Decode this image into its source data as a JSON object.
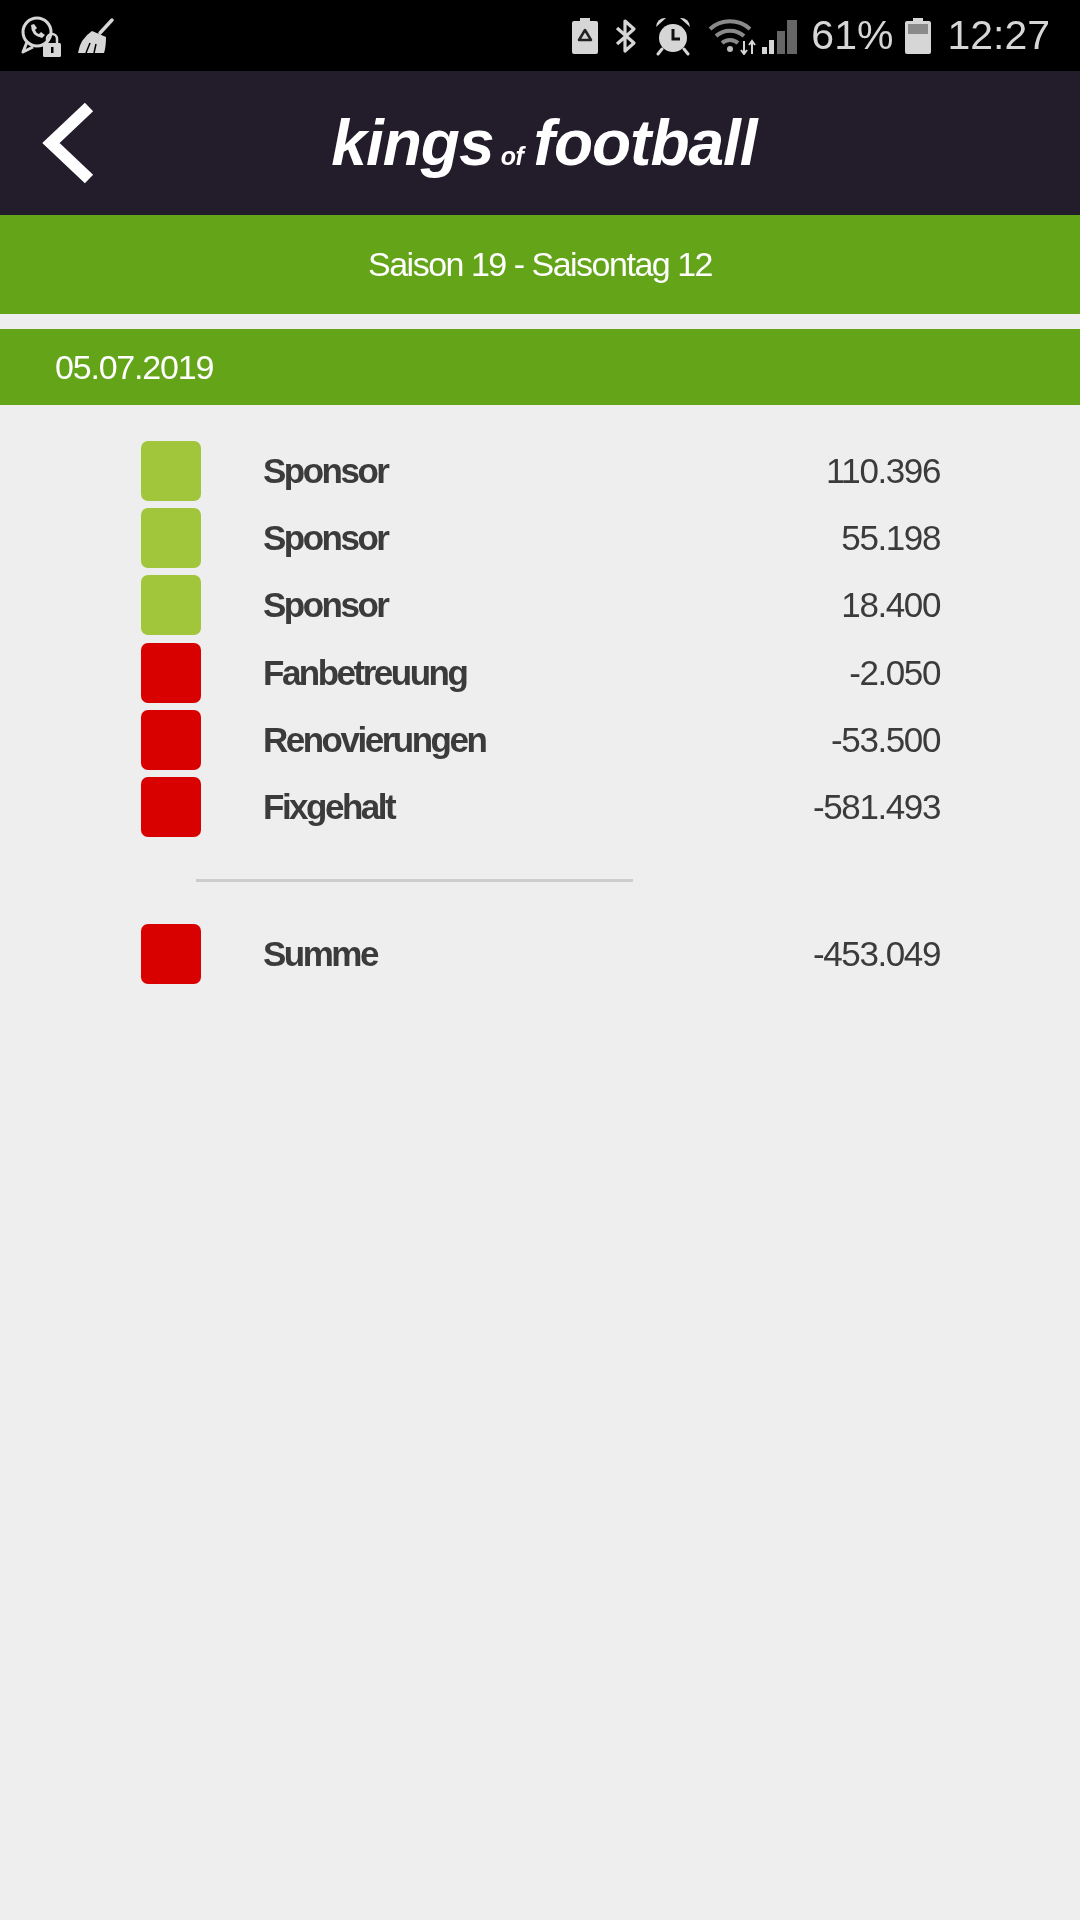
{
  "status_bar": {
    "battery_percent": "61%",
    "time": "12:27"
  },
  "header": {
    "logo": [
      {
        "text": "kings",
        "kind": "word"
      },
      {
        "text": "of",
        "kind": "small"
      },
      {
        "text": "football",
        "kind": "word"
      }
    ]
  },
  "season_bar": {
    "title": "Saison 19 - Saisontag 12"
  },
  "date_bar": {
    "date": "05.07.2019"
  },
  "entries": [
    {
      "label": "Sponsor",
      "amount": "110.396",
      "color": "#a2c63b"
    },
    {
      "label": "Sponsor",
      "amount": "55.198",
      "color": "#a2c63b"
    },
    {
      "label": "Sponsor",
      "amount": "18.400",
      "color": "#a2c63b"
    },
    {
      "label": "Fanbetreuung",
      "amount": "-2.050",
      "color": "#d90000"
    },
    {
      "label": "Renovierungen",
      "amount": "-53.500",
      "color": "#d90000"
    },
    {
      "label": "Fixgehalt",
      "amount": "-581.493",
      "color": "#d90000"
    }
  ],
  "total": {
    "label": "Summe",
    "amount": "-453.049",
    "color": "#d90000"
  }
}
